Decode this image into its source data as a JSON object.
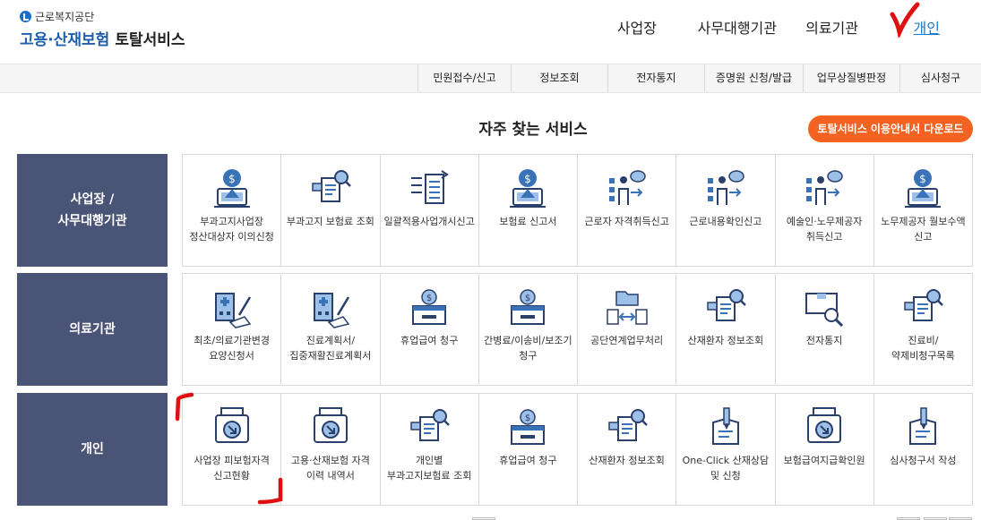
{
  "header": {
    "org": "근로복지공단",
    "service_blue": "고용·산재보험",
    "service_dark": "토탈서비스",
    "nav": [
      "사업장",
      "사무대행기관",
      "의료기관",
      "개인"
    ]
  },
  "subnav": [
    "민원접수/신고",
    "정보조회",
    "전자통지",
    "증명원 신청/발급",
    "업무상질병판정",
    "심사청구"
  ],
  "section_title": "자주 찾는 서비스",
  "download_button": "토탈서비스 이용안내서 다운로드",
  "rows": [
    {
      "category": [
        "사업장 /",
        "사무대행기관"
      ],
      "items": [
        {
          "label": "부과고지사업장 정산대상자 이의신청",
          "icon": "coin-monitor-icon"
        },
        {
          "label": "부과고지 보험료 조회",
          "icon": "document-search-icon"
        },
        {
          "label": "일괄적용사업개시신고",
          "icon": "document-list-icon"
        },
        {
          "label": "보험료 신고서",
          "icon": "coin-monitor-icon"
        },
        {
          "label": "근로자 자격취득신고",
          "icon": "person-chat-icon"
        },
        {
          "label": "근로내용확인신고",
          "icon": "person-chat-icon"
        },
        {
          "label": "예술인·노무제공자 취득신고",
          "icon": "person-chat-icon"
        },
        {
          "label": "노무제공자 월보수액 신고",
          "icon": "coin-monitor-icon"
        }
      ]
    },
    {
      "category": [
        "의료기관"
      ],
      "items": [
        {
          "label": "최초/의료기관변경 요양신청서",
          "icon": "hospital-docs-icon"
        },
        {
          "label": "진료계획서/집중재활진료계획서",
          "icon": "hospital-docs-icon"
        },
        {
          "label": "휴업급여 청구",
          "icon": "coin-box-icon"
        },
        {
          "label": "간병료/이송비/보조기 청구",
          "icon": "coin-box-icon"
        },
        {
          "label": "공단연계업무처리",
          "icon": "folder-exchange-icon"
        },
        {
          "label": "산재환자 정보조회",
          "icon": "document-search-icon"
        },
        {
          "label": "전자통지",
          "icon": "box-search-icon"
        },
        {
          "label": "진료비/약제비청구목록",
          "icon": "document-search-icon"
        }
      ]
    },
    {
      "category": [
        "개인"
      ],
      "items": [
        {
          "label": "사업장 피보험자격 신고현황",
          "icon": "printer-doc-icon"
        },
        {
          "label": "고용·산재보험 자격 이력 내역서",
          "icon": "printer-doc-icon"
        },
        {
          "label": "개인별 부과고지보험료 조회",
          "icon": "document-search-icon"
        },
        {
          "label": "휴업급여 청구",
          "icon": "coin-box-icon"
        },
        {
          "label": "산재환자 정보조회",
          "icon": "document-search-icon"
        },
        {
          "label": "One-Click 산재상담 및 신청",
          "icon": "clipboard-pen-icon"
        },
        {
          "label": "보험급여지급확인원",
          "icon": "printer-doc-icon"
        },
        {
          "label": "심사청구서 작성",
          "icon": "clipboard-pen-icon"
        }
      ]
    }
  ],
  "colors": {
    "category_bg": "#4a5476",
    "accent_orange": "#f26322",
    "icon_blue": "#3a72b8",
    "annotation_red": "#e01010"
  }
}
